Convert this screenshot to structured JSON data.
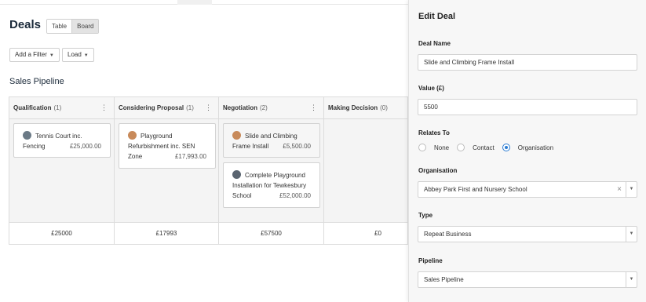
{
  "page": {
    "title": "Deals"
  },
  "view_toggle": {
    "table": "Table",
    "board": "Board",
    "active": "Board"
  },
  "toolbar": {
    "add_filter": "Add a Filter",
    "load": "Load"
  },
  "pipeline_title": "Sales Pipeline",
  "columns": [
    {
      "name": "Qualification",
      "count": "(1)",
      "total": "£25000",
      "cards": [
        {
          "line1": "Tennis Court inc.",
          "line2": "Fencing",
          "amount": "£25,000.00"
        }
      ]
    },
    {
      "name": "Considering Proposal",
      "count": "(1)",
      "total": "£17993",
      "cards": [
        {
          "line1": "Playground",
          "line2": "Refurbishment inc. SEN",
          "line3": "Zone",
          "amount": "£17,993.00"
        }
      ]
    },
    {
      "name": "Negotiation",
      "count": "(2)",
      "total": "£57500",
      "cards": [
        {
          "line1": "Slide and Climbing",
          "line2": "Frame Install",
          "amount": "£5,500.00"
        },
        {
          "line1": "Complete Playground",
          "line2": "Installation for Tewkesbury",
          "line3": "School",
          "amount": "£52,000.00"
        }
      ]
    },
    {
      "name": "Making Decision",
      "count": "(0)",
      "total": "£0",
      "cards": []
    }
  ],
  "edit_panel": {
    "title": "Edit Deal",
    "deal_name_label": "Deal Name",
    "deal_name_value": "Slide and Climbing Frame Install",
    "value_label": "Value (£)",
    "value_value": "5500",
    "relates_to_label": "Relates To",
    "relates_options": [
      "None",
      "Contact",
      "Organisation"
    ],
    "relates_selected": "Organisation",
    "organisation_label": "Organisation",
    "organisation_value": "Abbey Park First and Nursery School",
    "type_label": "Type",
    "type_value": "Repeat Business",
    "pipeline_label": "Pipeline",
    "pipeline_value": "Sales Pipeline"
  },
  "colors": {
    "accent": "#2b7cd3",
    "border": "#dcdcdc",
    "panel_bg": "#f7f7f7"
  }
}
